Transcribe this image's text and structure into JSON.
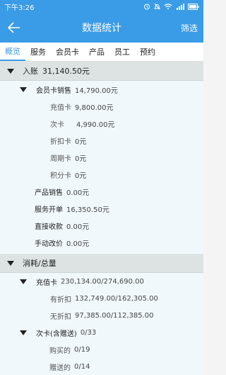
{
  "status": {
    "time": "下午3:26"
  },
  "header": {
    "title": "数据统计",
    "filter_label": "筛选"
  },
  "tabs": [
    "概览",
    "服务",
    "会员卡",
    "产品",
    "员工",
    "预约"
  ],
  "income": {
    "label": "入账",
    "value": "31,140.50元",
    "member_sales": {
      "label": "会员卡销售",
      "value": "14,790.00元",
      "items": [
        {
          "label": "充值卡",
          "value": "9,800.00元"
        },
        {
          "label": "次卡",
          "value": "4,990.00元"
        },
        {
          "label": "折扣卡",
          "value": "0元"
        },
        {
          "label": "周期卡",
          "value": "0元"
        },
        {
          "label": "积分卡",
          "value": "0元"
        }
      ]
    },
    "others": [
      {
        "label": "产品销售",
        "value": "0.00元"
      },
      {
        "label": "服务开单",
        "value": "16,350.50元"
      },
      {
        "label": "直接收款",
        "value": "0.00元"
      },
      {
        "label": "手动改价",
        "value": "0.00元"
      }
    ]
  },
  "consume": {
    "label": "消耗/总量",
    "recharge": {
      "label": "充值卡",
      "value": "230,134.00/274,690.00",
      "items": [
        {
          "label": "有折扣",
          "value": "132,749.00/162,305.00"
        },
        {
          "label": "无折扣",
          "value": "97,385.00/112,385.00"
        }
      ]
    },
    "times": {
      "label": "次卡(含赠送)",
      "value": "0/33",
      "items": [
        {
          "label": "购买的",
          "value": "0/19"
        },
        {
          "label": "赠送的",
          "value": "0/14"
        }
      ]
    }
  },
  "colors": {
    "primary": "#3a9be6",
    "section_bg": "#dde3e3",
    "content_bg": "#f1f8fc"
  }
}
